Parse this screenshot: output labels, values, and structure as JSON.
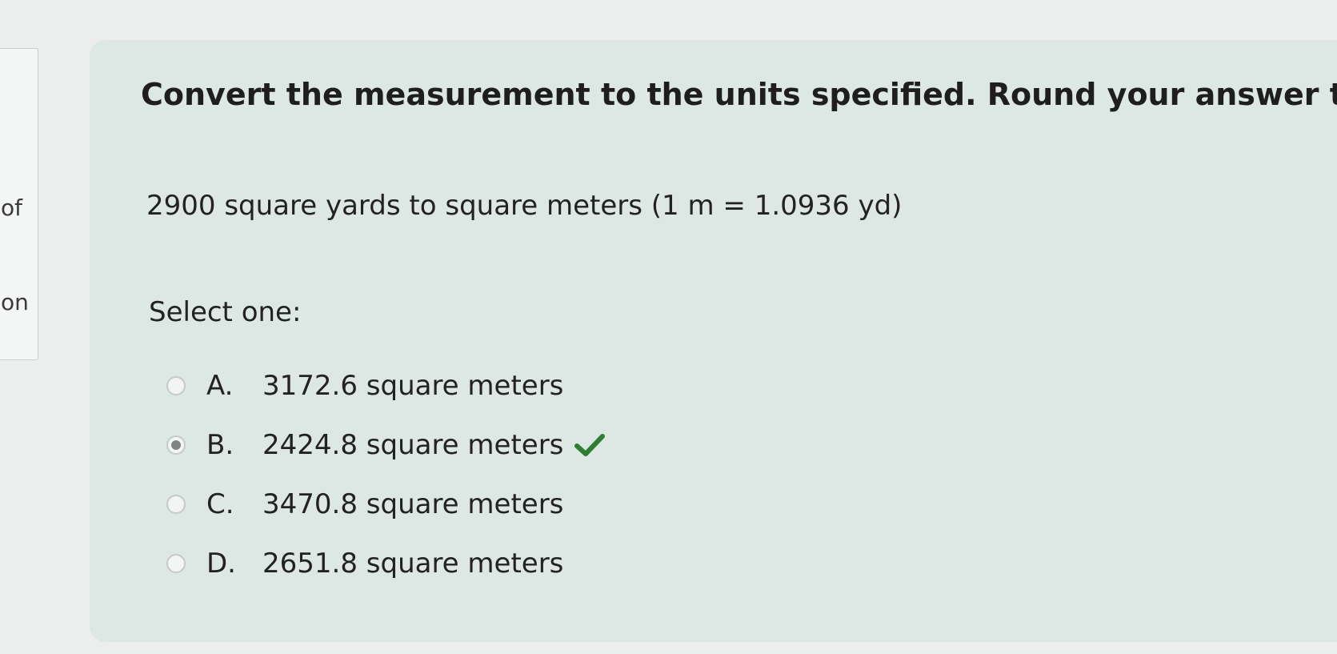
{
  "sidebar": {
    "words": [
      "of",
      "on"
    ]
  },
  "question": {
    "title": "Convert the measurement to the units specified. Round your answer to",
    "body": "2900 square yards to square meters (1 m = 1.0936 yd)",
    "prompt": "Select one:",
    "options": [
      {
        "letter": "A.",
        "text": "3172.6 square meters",
        "selected": false,
        "correct": false
      },
      {
        "letter": "B.",
        "text": "2424.8 square meters",
        "selected": true,
        "correct": true
      },
      {
        "letter": "C.",
        "text": "3470.8 square meters",
        "selected": false,
        "correct": false
      },
      {
        "letter": "D.",
        "text": "2651.8 square meters",
        "selected": false,
        "correct": false
      }
    ]
  },
  "colors": {
    "card_background": "#dde7e3",
    "check_green": "#2e7d32"
  },
  "icons": {
    "correct": "check-icon"
  }
}
